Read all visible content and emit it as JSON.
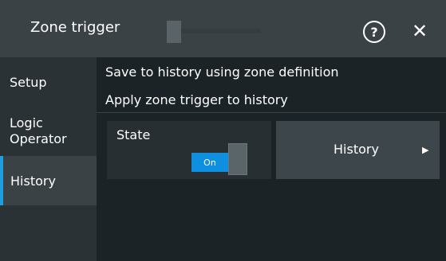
{
  "dialog": {
    "title": "Zone trigger",
    "help_glyph": "?",
    "close_glyph": "✕",
    "help_icon": "question-circle-icon",
    "close_icon": "close-icon"
  },
  "sidebar": {
    "tabs": [
      {
        "label": "Setup",
        "active": false
      },
      {
        "label": "Logic Operator",
        "active": false
      },
      {
        "label": "History",
        "active": true
      }
    ]
  },
  "content": {
    "line1": "Save to history using zone definition",
    "line2": "Apply zone trigger to history",
    "state": {
      "label": "State",
      "toggle_text": "On",
      "value": "on"
    },
    "history_button": {
      "label": "History",
      "arrow_glyph": "▶"
    }
  },
  "colors": {
    "accent": "#1e9fe0",
    "toggle_on": "#0f8fe0",
    "header_bg": "#3a4246",
    "content_bg": "#1b2326"
  }
}
